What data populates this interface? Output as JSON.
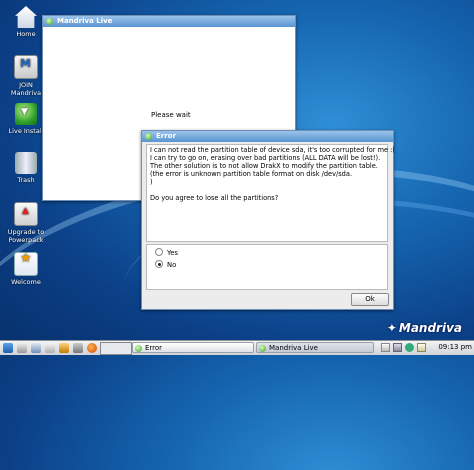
{
  "desktop": {
    "icons": [
      {
        "label": "Home",
        "icon": "home-icon"
      },
      {
        "label": "JOIN Mandriva",
        "icon": "join-mandriva-icon"
      },
      {
        "label": "Live Install",
        "icon": "live-install-icon"
      },
      {
        "label": "Trash",
        "icon": "trash-icon"
      },
      {
        "label": "Upgrade to Powerpack",
        "icon": "upgrade-icon"
      },
      {
        "label": "Welcome",
        "icon": "welcome-icon"
      }
    ],
    "brand": "Mandriva"
  },
  "live_window": {
    "title": "Mandriva Live",
    "status": "Please wait"
  },
  "error_dialog": {
    "title": "Error",
    "message_lines": [
      "I can not read the partition table of device sda, it's too corrupted for me :(",
      "I can try to go on, erasing over bad partitions (ALL DATA will be lost!).",
      "The other solution is to not allow DrakX to modify the partition table.",
      "(the error is unknown partition table format on disk /dev/sda.",
      ")",
      "",
      "Do you agree to lose all the partitions?"
    ],
    "options": [
      {
        "label": "Yes",
        "selected": false
      },
      {
        "label": "No",
        "selected": true
      }
    ],
    "ok_label": "Ok"
  },
  "taskbar": {
    "tasks": [
      {
        "label": "Error",
        "active": false
      },
      {
        "label": "Mandriva Live",
        "active": true
      }
    ],
    "clock": "09:13 pm"
  }
}
